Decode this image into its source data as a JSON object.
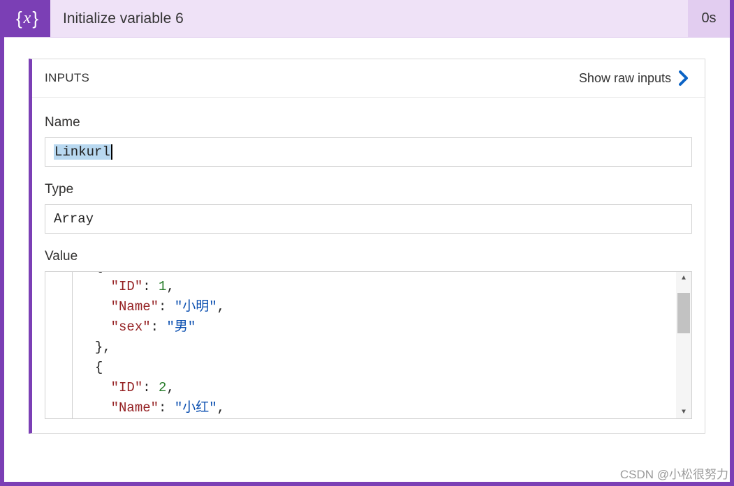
{
  "header": {
    "icon_label": "{x}",
    "title": "Initialize variable 6",
    "duration": "0s"
  },
  "inputs_panel": {
    "heading": "INPUTS",
    "show_raw_label": "Show raw inputs",
    "fields": {
      "name": {
        "label": "Name",
        "value": "Linkurl"
      },
      "type": {
        "label": "Type",
        "value": "Array"
      },
      "value": {
        "label": "Value",
        "json_value": [
          {
            "ID": 1,
            "Name": "小明",
            "sex": "男"
          },
          {
            "ID": 2,
            "Name": "小红"
          }
        ]
      }
    }
  },
  "watermark": "CSDN @小松很努力"
}
